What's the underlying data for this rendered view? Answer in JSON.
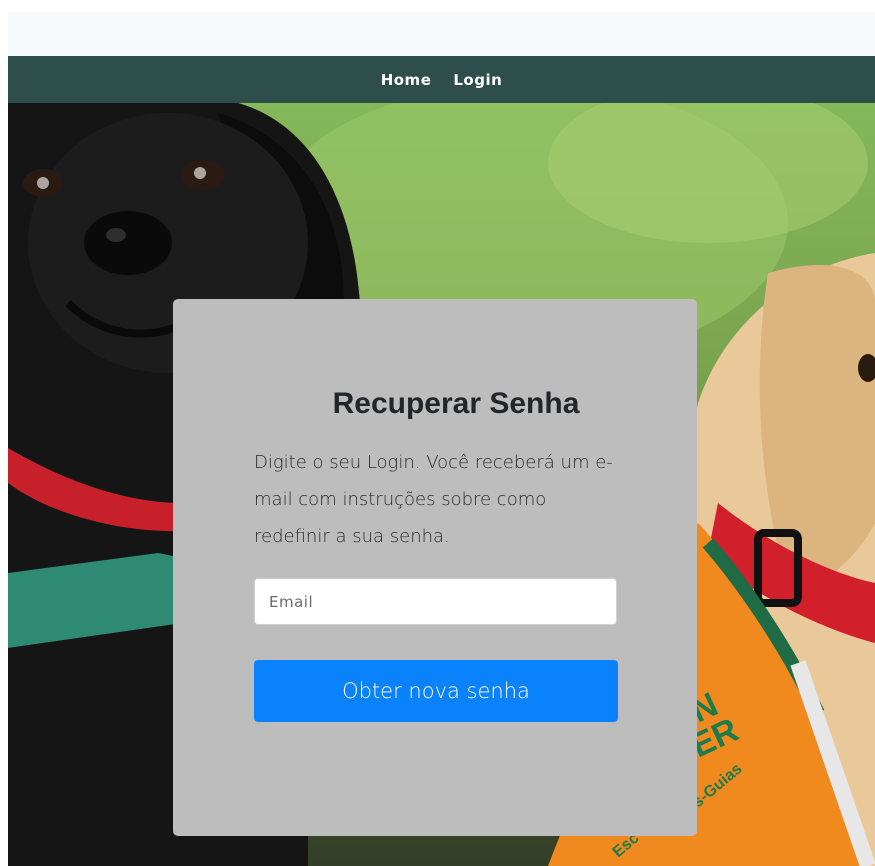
{
  "nav": {
    "items": [
      {
        "label": "Home"
      },
      {
        "label": "Login"
      }
    ]
  },
  "recover": {
    "title": "Recuperar Senha",
    "description": "Digite o seu Login. Você receberá um e-mail com instruções sobre como redefinir a sua senha.",
    "email_placeholder": "Email",
    "email_value": "",
    "submit_label": "Obter nova senha"
  },
  "hero": {
    "subject": "black-labrador-puppy and yellow-labrador-puppy in guide-dog vest",
    "vest_text_lines": [
      "N",
      "ER",
      "s-Guias",
      "Esc"
    ]
  },
  "colors": {
    "navbar": "#2e4e4c",
    "topbar": "#f7f8fa",
    "card": "#bdbdbd",
    "button": "#0a82fb",
    "title_text": "#232629"
  }
}
